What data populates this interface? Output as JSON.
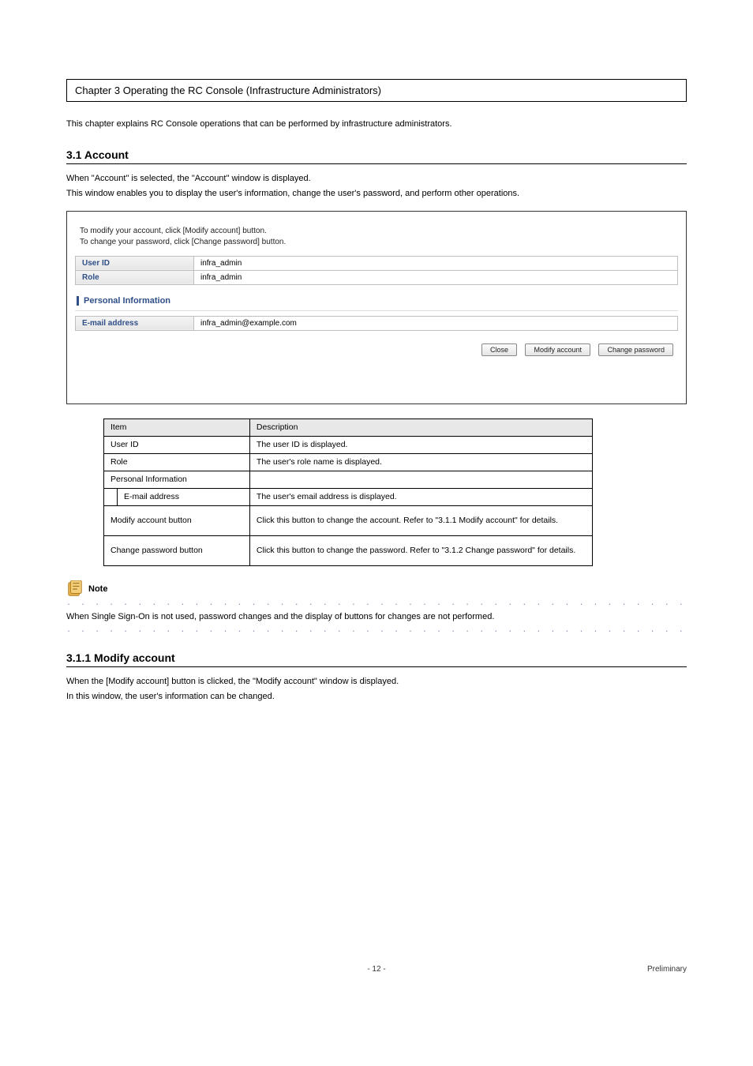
{
  "chapter_title": "Chapter 3 Operating the RC Console (Infrastructure Administrators)",
  "intro": "This chapter explains RC Console operations that can be performed by infrastructure administrators.",
  "h2_1": "3.1 Account",
  "body1_line1": "When \"Account\" is selected, the \"Account\" window is displayed.",
  "body1_line2": "This window enables you to display the user's information, change the user's password, and perform other operations.",
  "screenshot": {
    "instr_line1": "To modify your account, click [Modify account] button.",
    "instr_line2": "To change your password, click [Change password] button.",
    "rows": [
      {
        "label": "User ID",
        "value": "infra_admin"
      },
      {
        "label": "Role",
        "value": "infra_admin"
      }
    ],
    "section_title": "Personal Information",
    "email_label": "E-mail address",
    "email_value": "infra_admin@example.com",
    "buttons": {
      "close": "Close",
      "modify": "Modify account",
      "change_pw": "Change password"
    }
  },
  "def_table": {
    "header_item": "Item",
    "header_desc": "Description",
    "rows": [
      {
        "item": "User ID",
        "desc": "The user ID is displayed.",
        "indent": false,
        "tall": false
      },
      {
        "item": "Role",
        "desc": "The user's role name is displayed.",
        "indent": false,
        "tall": false
      },
      {
        "item": "Personal Information",
        "desc": "",
        "indent": false,
        "tall": false
      },
      {
        "item": "E-mail address",
        "desc": "The user's email address is displayed.",
        "indent": true,
        "tall": false
      },
      {
        "item": "Modify account button",
        "desc": "Click this button to change the account. Refer to \"3.1.1 Modify account\" for details.",
        "indent": false,
        "tall": true
      },
      {
        "item": "Change password button",
        "desc": "Click this button to change the password. Refer to \"3.1.2 Change password\" for details.",
        "indent": false,
        "tall": true
      }
    ]
  },
  "note": {
    "title": "Note",
    "body": "When Single Sign-On is not used, password changes and the display of buttons for changes are not performed."
  },
  "h2_2": "3.1.1 Modify account",
  "body2_line1": "When the [Modify account] button is clicked, the \"Modify account\" window is displayed.",
  "body2_line2": "In this window, the user's information can be changed.",
  "footer_center": "- 12 -",
  "footer_right": "Preliminary"
}
